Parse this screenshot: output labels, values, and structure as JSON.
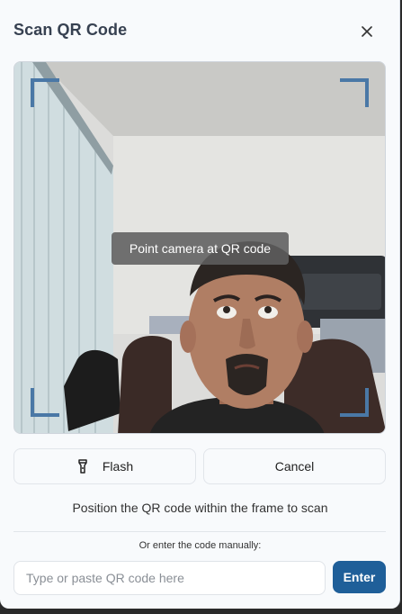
{
  "dialog": {
    "title": "Scan QR Code",
    "close_icon": "close-icon"
  },
  "camera": {
    "overlay_text": "Point camera at QR code",
    "frame_color": "#4a78a6"
  },
  "actions": {
    "flash_label": "Flash",
    "flash_icon": "flashlight-icon",
    "cancel_label": "Cancel"
  },
  "instructions": "Position the QR code within the frame to scan",
  "manual_entry": {
    "label": "Or enter the code manually:",
    "placeholder": "Type or paste QR code here",
    "value": "",
    "submit_label": "Enter",
    "accent_color": "#1f5f99"
  }
}
